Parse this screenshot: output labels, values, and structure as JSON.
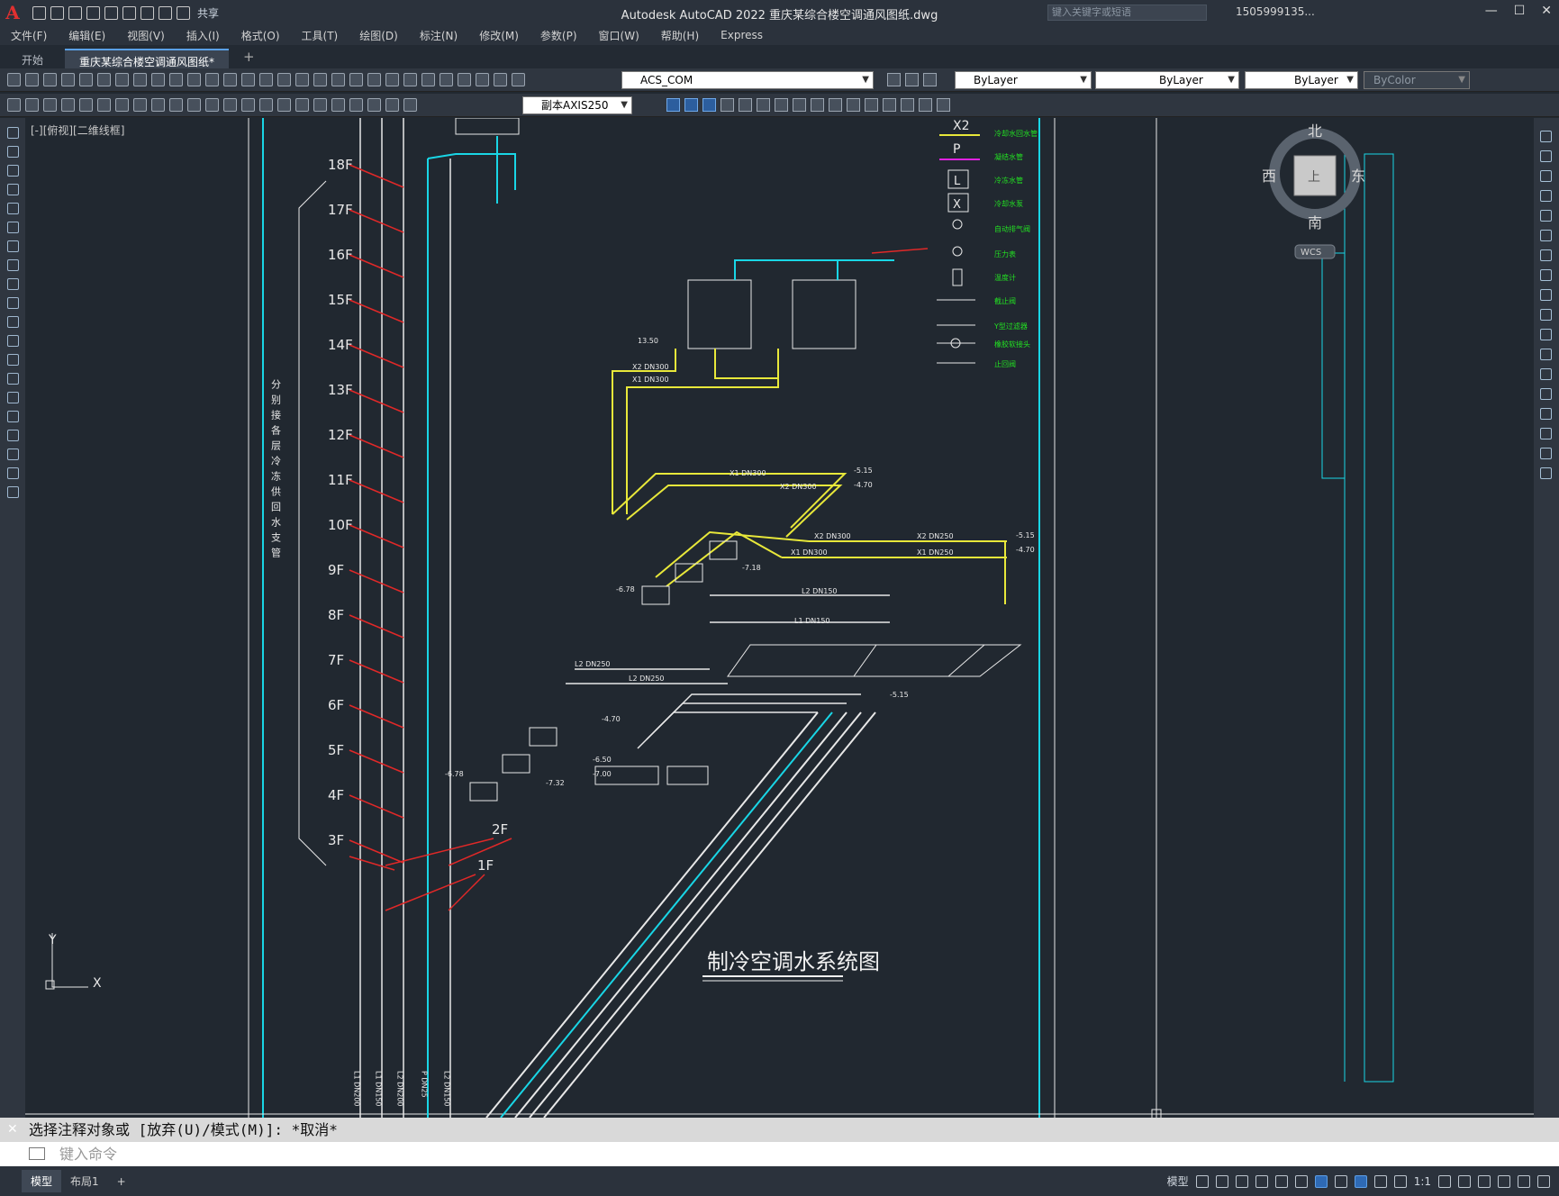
{
  "app": {
    "title": "Autodesk AutoCAD 2022    重庆某综合楼空调通风图纸.dwg",
    "logo": "A",
    "share_label": "共享",
    "search_placeholder": "键入关键字或短语",
    "user": "1505999135...",
    "window_controls": [
      "—",
      "☐",
      "✕"
    ]
  },
  "menu": [
    "文件(F)",
    "编辑(E)",
    "视图(V)",
    "插入(I)",
    "格式(O)",
    "工具(T)",
    "绘图(D)",
    "标注(N)",
    "修改(M)",
    "参数(P)",
    "窗口(W)",
    "帮助(H)",
    "Express"
  ],
  "tabs": [
    {
      "label": "开始",
      "active": false
    },
    {
      "label": "重庆某综合楼空调通风图纸*",
      "active": true
    }
  ],
  "toolbar": {
    "layer": "ACS_COM",
    "color": "ByLayer",
    "linetype": "ByLayer",
    "lineweight": "ByLayer",
    "plotstyle": "ByColor",
    "dimstyle": "副本AXIS250"
  },
  "viewport": {
    "label": "[-][俯视][二维线框]",
    "viewcube": {
      "north": "北",
      "south": "南",
      "east": "东",
      "west": "西",
      "face": "上",
      "wcs": "WCS"
    },
    "ucs": {
      "x": "X",
      "y": "Y"
    }
  },
  "drawing": {
    "title": "制冷空调水系统图",
    "vertical_note": "分别接各层冷冻供回水支管",
    "floors": [
      "18F",
      "17F",
      "16F",
      "15F",
      "14F",
      "13F",
      "12F",
      "11F",
      "10F",
      "9F",
      "8F",
      "7F",
      "6F",
      "5F",
      "4F",
      "3F"
    ],
    "lower_floors": [
      "2F",
      "1F"
    ],
    "legend": [
      {
        "symbol": "X2",
        "label": "冷却水回水管"
      },
      {
        "symbol": "P",
        "label": "凝结水管"
      },
      {
        "symbol": "L",
        "label": "冷冻水管"
      },
      {
        "symbol": "X",
        "label": "冷却水泵"
      },
      {
        "symbol": "vent",
        "label": "自动排气阀"
      },
      {
        "symbol": "gauge",
        "label": "压力表"
      },
      {
        "symbol": "thermo",
        "label": "温度计"
      },
      {
        "symbol": "valve",
        "label": "截止阀"
      },
      {
        "symbol": "strainer",
        "label": "Y型过滤器"
      },
      {
        "symbol": "joint",
        "label": "橡胶软接头"
      },
      {
        "symbol": "check",
        "label": "止回阀"
      }
    ],
    "pipe_labels": [
      "X2 DN300",
      "X1 DN300",
      "X2 DN250",
      "X1 DN250",
      "L2 DN250",
      "L2 DN150",
      "L1 DN150",
      "L2 DN200",
      "L1 DN200",
      "P DN25",
      "X1 DN300",
      "X2 DN300"
    ],
    "elevations": [
      "-5.15",
      "-4.70",
      "13.50",
      "-6.78",
      "-7.18",
      "-7.32",
      "-6.50",
      "-7.00",
      "-5.15",
      "-4.70"
    ],
    "riser_labels": [
      "L1 DN200",
      "L1 DN150",
      "L2 DN200",
      "P DN25",
      "L2 DN150"
    ]
  },
  "command": {
    "history": "选择注释对象或 [放弃(U)/模式(M)]: *取消*",
    "placeholder": "键入命令"
  },
  "status": {
    "tabs": [
      "模型",
      "布局1"
    ],
    "model_label": "模型",
    "scale": "1:1"
  },
  "colors": {
    "background": "#212830",
    "cyan": "#19d6e6",
    "yellow": "#e8e83a",
    "red": "#e02828",
    "green": "#22e022",
    "white": "#e8e8e8",
    "magenta": "#e022e0"
  }
}
